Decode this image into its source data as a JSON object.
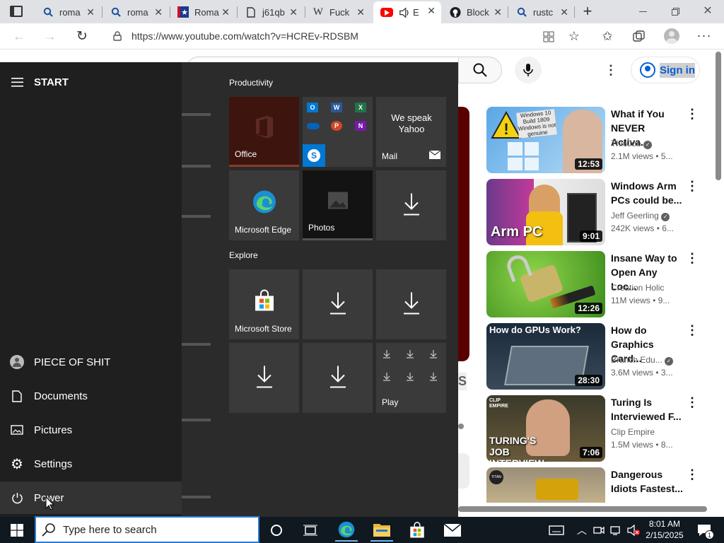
{
  "browser": {
    "tabs": [
      {
        "label": "roma",
        "icon": "search-icon"
      },
      {
        "label": "roma",
        "icon": "search-icon"
      },
      {
        "label": "Roma",
        "icon": "flag-icon"
      },
      {
        "label": "j61qb",
        "icon": "document-icon"
      },
      {
        "label": "Fuck",
        "icon": "wikipedia-icon"
      },
      {
        "label": "E",
        "icon": "youtube-icon"
      },
      {
        "label": "Block",
        "icon": "github-icon"
      },
      {
        "label": "rustc",
        "icon": "search-icon"
      }
    ],
    "url": "https://www.youtube.com/watch?v=HCREv-RDSBM",
    "wiki_glyph": "W",
    "new_tab_glyph": "+"
  },
  "youtube": {
    "sign_in": "Sign in",
    "partial_letter": "S",
    "videos": [
      {
        "title": "What if You NEVER Activa...",
        "channel": "ThioJoe",
        "verified": true,
        "views": "2.1M views • 5...",
        "duration": "12:53",
        "thumb_text": "Windows 10 Build 1809 Windows is not genuine"
      },
      {
        "title": "Windows Arm PCs could be...",
        "channel": "Jeff Geerling",
        "verified": true,
        "views": "242K views • 6...",
        "duration": "9:01",
        "thumb_text": "Arm PC"
      },
      {
        "title": "Insane Way to Open Any Loc...",
        "channel": "Creation Holic",
        "verified": false,
        "views": "11M views • 9...",
        "duration": "12:26",
        "thumb_text": ""
      },
      {
        "title": "How do Graphics Card...",
        "channel": "Branch Edu...",
        "verified": true,
        "views": "3.6M views • 3...",
        "duration": "28:30",
        "thumb_text": "How do GPUs Work?"
      },
      {
        "title": "Turing Is Interviewed F...",
        "channel": "Clip Empire",
        "verified": false,
        "views": "1.5M views • 8...",
        "duration": "7:06",
        "thumb_text": "TURING'S JOB INTERVIEW",
        "thumb_small": "CLIP EMPIRE"
      },
      {
        "title": "Dangerous Idiots Fastest...",
        "channel": "",
        "verified": false,
        "views": "",
        "duration": "",
        "thumb_text": "TITAN"
      }
    ]
  },
  "start_menu": {
    "header": "START",
    "user": "PIECE OF SHIT",
    "items": [
      "Documents",
      "Pictures",
      "Settings",
      "Power"
    ],
    "groups": [
      "Productivity",
      "Explore"
    ],
    "tiles": {
      "office": "Office",
      "mail": "Mail",
      "mail_text": "We speak Yahoo",
      "edge": "Microsoft Edge",
      "photos": "Photos",
      "store": "Microsoft Store",
      "play": "Play"
    },
    "office_apps": [
      {
        "letter": "O",
        "color": "#0078d4"
      },
      {
        "letter": "W",
        "color": "#2b579a"
      },
      {
        "letter": "X",
        "color": "#217346"
      },
      {
        "letter": "",
        "color": "#0364b8"
      },
      {
        "letter": "P",
        "color": "#d24726"
      },
      {
        "letter": "N",
        "color": "#7719aa"
      },
      {
        "letter": "S",
        "color": "#00a4ef"
      }
    ]
  },
  "taskbar": {
    "search_placeholder": "Type here to search",
    "time": "8:01 AM",
    "date": "2/15/2025",
    "notification_count": "1"
  },
  "colors": {
    "taskbar": "#101820",
    "start_left": "#1f1f1f",
    "start_tiles": "#2b2b2b",
    "accent": "#0078d4"
  }
}
